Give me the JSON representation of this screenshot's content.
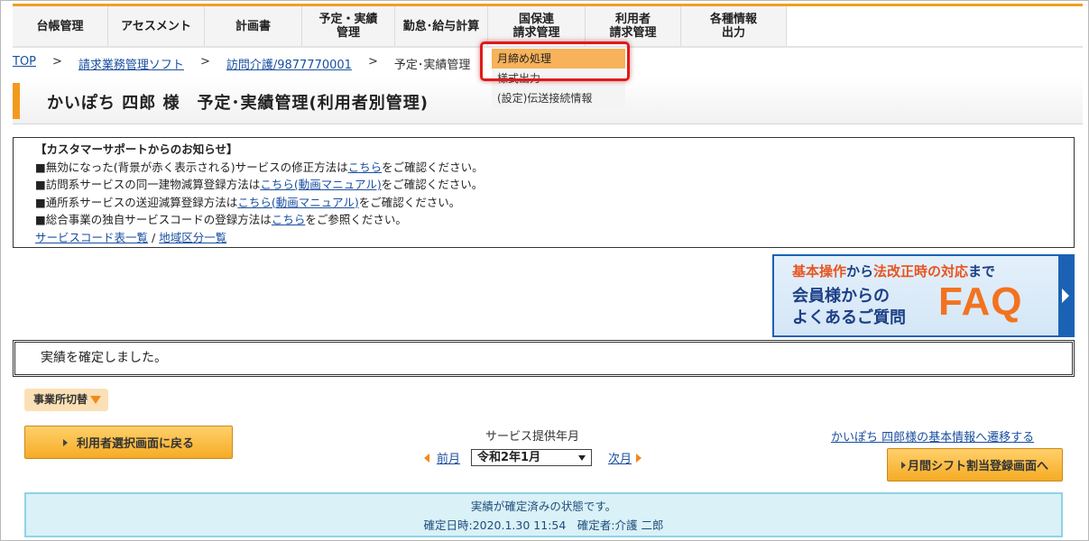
{
  "nav": {
    "items": [
      {
        "label": "台帳管理"
      },
      {
        "label": "アセスメント"
      },
      {
        "label": "計画書"
      },
      {
        "label": "予定・実績\n管理"
      },
      {
        "label": "勤怠･給与計算"
      },
      {
        "label": "国保連\n請求管理"
      },
      {
        "label": "利用者\n請求管理"
      },
      {
        "label": "各種情報\n出力"
      }
    ]
  },
  "dropdown": {
    "items": [
      "月締め処理",
      "様式出力",
      "(設定)伝送接続情報"
    ],
    "active_index": 0
  },
  "breadcrumb": {
    "items": [
      "TOP",
      "請求業務管理ソフト",
      "訪問介護/9877770001"
    ],
    "current": "予定･実績管理",
    "separator": ">"
  },
  "page_title": "かいぽち 四郎 様　予定･実績管理(利用者別管理)",
  "notice": {
    "heading": "【カスタマーサポートからのお知らせ】",
    "lines": [
      {
        "pre": "■無効になった(背景が赤く表示される)サービスの修正方法は",
        "link": "こちら",
        "post": "をご確認ください。"
      },
      {
        "pre": "■訪問系サービスの同一建物減算登録方法は",
        "link": "こちら(動画マニュアル)",
        "post": "をご確認ください。"
      },
      {
        "pre": "■通所系サービスの送迎減算登録方法は",
        "link": "こちら(動画マニュアル)",
        "post": "をご確認ください。"
      },
      {
        "pre": "■総合事業の独自サービスコードの登録方法は",
        "link": "こちら",
        "post": "をご参照ください。"
      }
    ],
    "footer_link1": "サービスコード表一覧",
    "footer_sep": "/",
    "footer_link2": "地域区分一覧"
  },
  "faq_banner": {
    "line1_a": "基本操作",
    "line1_b": "から",
    "line1_c": "法改正時の対応",
    "line1_d": "まで",
    "line2": "会員様からの\nよくあるご質問",
    "big": "FAQ"
  },
  "message": "実績を確定しました。",
  "office_switch_label": "事業所切替",
  "back_button_label": "利用者選択画面に戻る",
  "service_month": {
    "label": "サービス提供年月",
    "prev": "前月",
    "selected": "令和2年1月",
    "next": "次月"
  },
  "basic_info_link": "かいぽち 四郎様の基本情報へ遷移する",
  "shift_button_label": "月間シフト割当登録画面へ",
  "status": {
    "line1": "実績が確定済みの状態です。",
    "line2": "確定日時:2020.1.30 11:54　確定者:介護 二郎"
  },
  "colors": {
    "accent_orange": "#f39a1e",
    "link_blue": "#1a4fa0",
    "highlight_red": "#e01a1a",
    "status_bg": "#d9f1f7"
  }
}
